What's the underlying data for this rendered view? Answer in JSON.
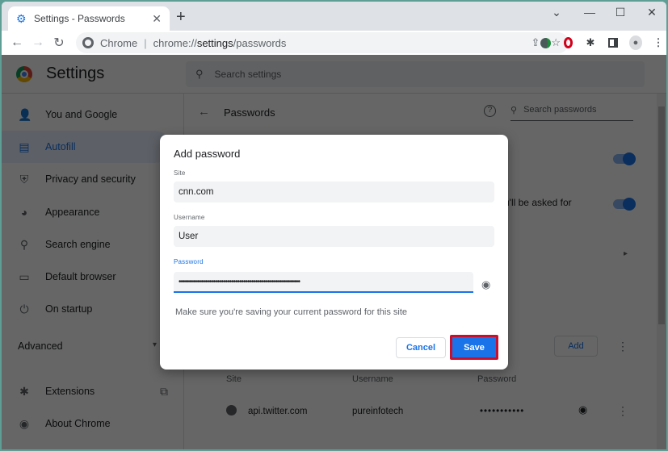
{
  "browser": {
    "tab_title": "Settings - Passwords",
    "tab_close": "✕",
    "new_tab": "+",
    "window_controls": {
      "dropdown": "⌄",
      "minimize": "—",
      "maximize": "☐",
      "close": "✕"
    },
    "omnibox": {
      "scheme_label": "Chrome",
      "separator": "|",
      "url_prefix": "chrome://",
      "url_host": "settings",
      "url_path": "/passwords"
    },
    "nav": {
      "back": "←",
      "forward": "→",
      "reload": "↻"
    },
    "toolbar_icons": [
      "share-icon",
      "bookmark-star-icon",
      "extension-vpn-icon",
      "opera-extension-icon",
      "extensions-puzzle-icon",
      "side-panel-icon",
      "profile-avatar-icon",
      "menu-kebab-icon"
    ]
  },
  "settings": {
    "title": "Settings",
    "search_placeholder": "Search settings",
    "sidebar": {
      "items": [
        {
          "label": "You and Google",
          "icon": "person-icon",
          "glyph": "👤"
        },
        {
          "label": "Autofill",
          "icon": "autofill-icon",
          "glyph": "▤",
          "active": true
        },
        {
          "label": "Privacy and security",
          "icon": "shield-icon",
          "glyph": "⛨"
        },
        {
          "label": "Appearance",
          "icon": "palette-icon",
          "glyph": "🎨"
        },
        {
          "label": "Search engine",
          "icon": "search-icon",
          "glyph": "⚲"
        },
        {
          "label": "Default browser",
          "icon": "browser-window-icon",
          "glyph": "▭"
        },
        {
          "label": "On startup",
          "icon": "power-icon",
          "glyph": "⏻"
        }
      ],
      "advanced_label": "Advanced",
      "advanced_arrow": "▾",
      "bottom_items": [
        {
          "label": "Extensions",
          "icon": "puzzle-icon",
          "glyph": "✱"
        },
        {
          "label": "About Chrome",
          "icon": "chrome-icon",
          "glyph": "◉"
        }
      ],
      "external_link_glyph": "⧉"
    },
    "passwords": {
      "back": "←",
      "title": "Passwords",
      "help": "?",
      "search_placeholder": "Search passwords",
      "partial_text": "u'll be asked for",
      "add_label": "Add",
      "columns": [
        "Site",
        "Username",
        "Password"
      ],
      "rows": [
        {
          "site": "api.twitter.com",
          "username": "pureinfotech",
          "password": "•••••••••••"
        }
      ],
      "toggles": [
        true,
        true
      ],
      "accent": "#1a73e8"
    }
  },
  "dialog": {
    "title": "Add password",
    "site_label": "Site",
    "site_value": "cnn.com",
    "username_label": "Username",
    "username_value": "User",
    "password_label": "Password",
    "password_value": "••••••••••••••••••••••••••••••••••••••••••••••••••••••••••••",
    "note": "Make sure you're saving your current password for this site",
    "cancel_label": "Cancel",
    "save_label": "Save",
    "save_highlight_color": "#c8102e"
  }
}
